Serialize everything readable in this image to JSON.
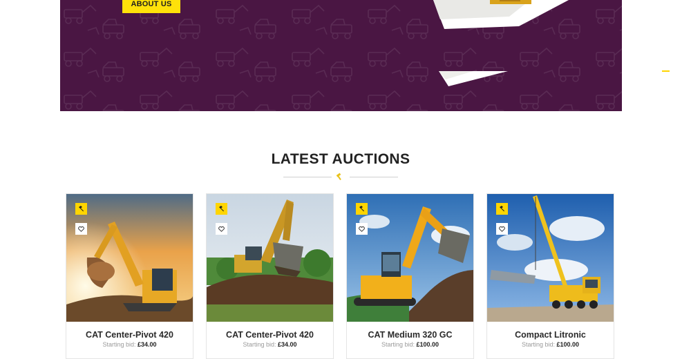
{
  "hero": {
    "about_button_label": "ABOUT US",
    "background_color": "#4a1643",
    "accent_color": "#ffe10a"
  },
  "section": {
    "title": "LATEST AUCTIONS",
    "divider_icon": "gavel-icon"
  },
  "auctions": [
    {
      "title": "CAT Center-Pivot 420",
      "bid_label": "Starting bid:",
      "bid_amount": "£34.00",
      "machine": "excavator-sunset",
      "badge_icon": "gavel-icon",
      "favorite_icon": "heart-icon"
    },
    {
      "title": "CAT Center-Pivot 420",
      "bid_label": "Starting bid:",
      "bid_amount": "£34.00",
      "machine": "excavator-dirt-pile",
      "badge_icon": "gavel-icon",
      "favorite_icon": "heart-icon"
    },
    {
      "title": "CAT Medium 320 GC",
      "bid_label": "Starting bid:",
      "bid_amount": "£100.00",
      "machine": "excavator-blue-sky",
      "badge_icon": "gavel-icon",
      "favorite_icon": "heart-icon"
    },
    {
      "title": "Compact Litronic",
      "bid_label": "Starting bid:",
      "bid_amount": "£100.00",
      "machine": "mobile-crane",
      "badge_icon": "gavel-icon",
      "favorite_icon": "heart-icon"
    }
  ]
}
